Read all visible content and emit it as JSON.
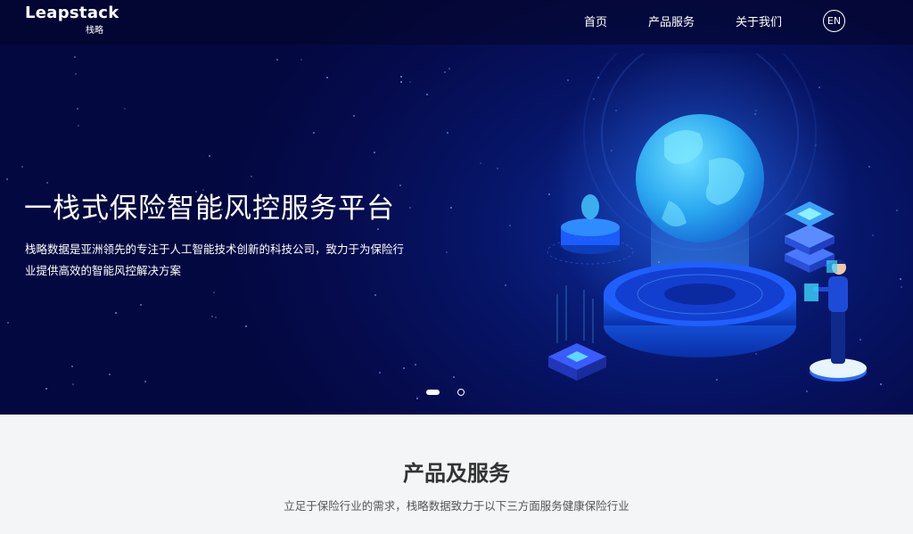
{
  "brand": {
    "name_en": "Leapstack",
    "name_cn": "栈略"
  },
  "nav": {
    "items": [
      {
        "label": "首页"
      },
      {
        "label": "产品服务"
      },
      {
        "label": "关于我们"
      }
    ],
    "lang_label": "EN"
  },
  "hero": {
    "title": "一栈式保险智能风控服务平台",
    "description": "栈略数据是亚洲领先的专注于人工智能技术创新的科技公司，致力于为保险行业提供高效的智能风控解决方案",
    "slides": {
      "count": 2,
      "active": 1
    }
  },
  "section": {
    "title": "产品及服务",
    "subtitle": "立足于保险行业的需求，栈略数据致力于以下三方面服务健康保险行业"
  },
  "colors": {
    "hero_dark": "#040840",
    "hero_mid": "#07166a",
    "accent_blue": "#1e6bff",
    "globe_cyan": "#37c6ff",
    "section_bg": "#f4f5f7"
  }
}
